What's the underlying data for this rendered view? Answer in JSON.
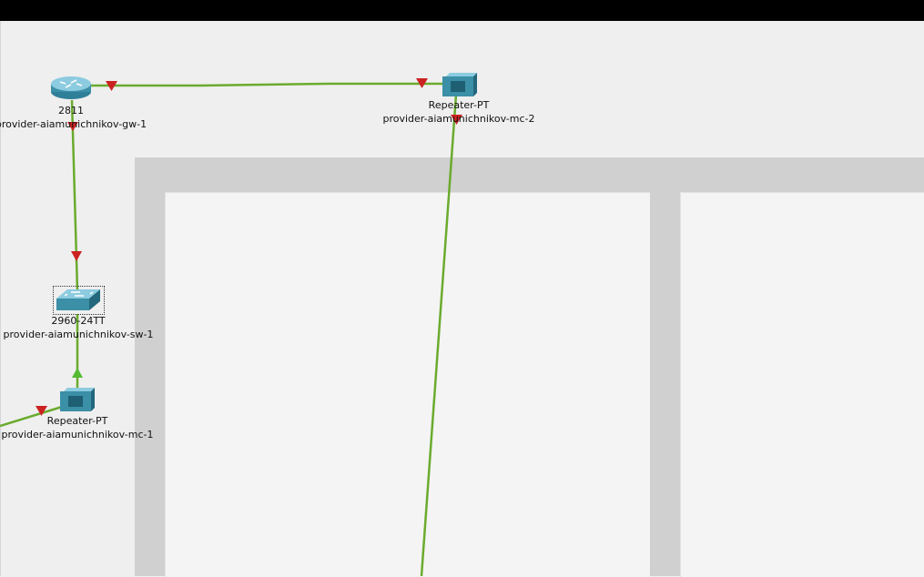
{
  "devices": {
    "gw1": {
      "model": "2811",
      "name": "provider-aiamunichnikov-gw-1"
    },
    "mc2": {
      "model": "Repeater-PT",
      "name": "provider-aiamunichnikov-mc-2"
    },
    "sw1": {
      "model": "2960-24TT",
      "name": "provider-aiamunichnikov-sw-1"
    },
    "mc1": {
      "model": "Repeater-PT",
      "name": "provider-aiamunichnikov-mc-1"
    }
  },
  "colors": {
    "link": "#6aab2e",
    "link_down": "#cc2222",
    "link_up": "#55bb33",
    "device_blue": "#3b8fa6"
  },
  "link_status": {
    "gw1_mc2": [
      "down",
      "down"
    ],
    "gw1_sw1": [
      "down",
      "down"
    ],
    "sw1_mc1": [
      "up"
    ],
    "mc1_offscreen": [
      "down"
    ],
    "mc2_offscreen": [
      "down"
    ]
  }
}
